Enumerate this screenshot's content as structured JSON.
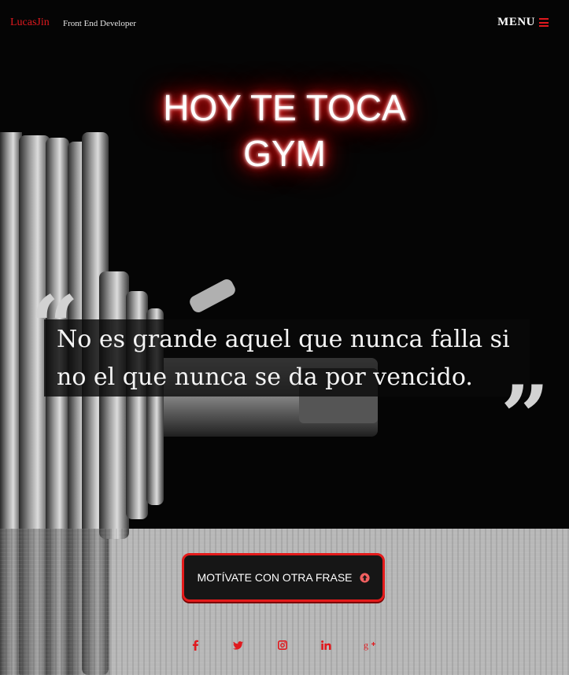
{
  "header": {
    "brand": "LucasJin",
    "subtitle": "Front End Developer",
    "menu_label": "MENU",
    "menu_icon": "hamburger-icon"
  },
  "hero": {
    "title_line1": "HOY TE TOCA",
    "title_line2": "GYM"
  },
  "quote": {
    "open_mark": "“",
    "text": "No es grande aquel que nunca falla si no el que nunca se da por vencido.",
    "close_mark": "”"
  },
  "cta": {
    "label": "MOTÍVATE CON OTRA FRASE",
    "icon": "arrow-up-circle-icon"
  },
  "social": [
    {
      "name": "facebook-icon"
    },
    {
      "name": "twitter-icon"
    },
    {
      "name": "instagram-icon"
    },
    {
      "name": "linkedin-icon"
    },
    {
      "name": "google-plus-icon"
    }
  ],
  "colors": {
    "accent": "#e0191e",
    "background": "#000000",
    "text": "#ffffff"
  }
}
